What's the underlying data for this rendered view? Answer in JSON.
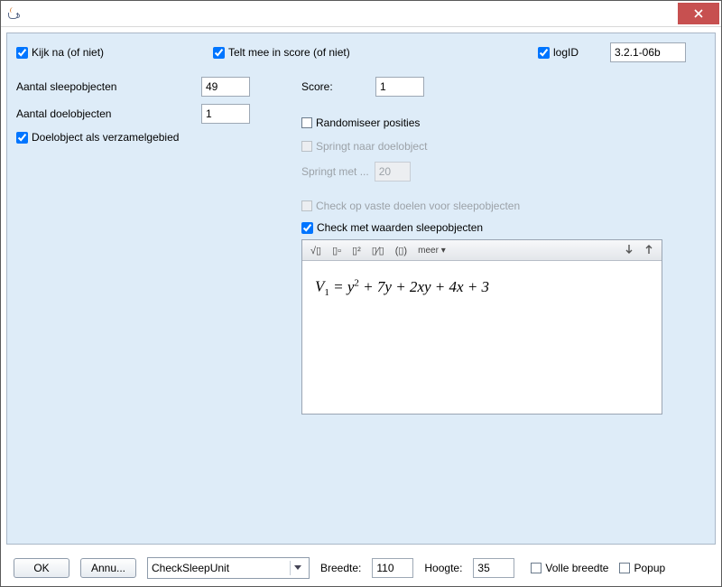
{
  "titlebar": {
    "title": ""
  },
  "top": {
    "kijk_na": {
      "label": "Kijk na (of niet)",
      "checked": true
    },
    "telt_mee": {
      "label": "Telt mee in score (of niet)",
      "checked": true
    },
    "logid_cb": {
      "label": "logID",
      "checked": true
    },
    "logid_value": "3.2.1-06b"
  },
  "left": {
    "aantal_sleep_label": "Aantal sleepobjecten",
    "aantal_sleep_value": "49",
    "aantal_doel_label": "Aantal doelobjecten",
    "aantal_doel_value": "1",
    "doel_verzamel": {
      "label": "Doelobject als verzamelgebied",
      "checked": true
    }
  },
  "right": {
    "score_label": "Score:",
    "score_value": "1",
    "randomiseer": {
      "label": "Randomiseer posities",
      "checked": false
    },
    "springt_doel": {
      "label": "Springt naar doelobject",
      "checked": false,
      "disabled": true
    },
    "springt_met_label": "Springt met ...",
    "springt_met_value": "20",
    "check_vaste": {
      "label": "Check op vaste doelen voor sleepobjecten",
      "checked": false,
      "disabled": true
    },
    "check_waarden": {
      "label": "Check met waarden sleepobjecten",
      "checked": true
    }
  },
  "eq_toolbar": {
    "b1": "√▯",
    "b2": "▯▫",
    "b3": "▯²",
    "b4": "▯⁄▯",
    "b5": "(▯)",
    "more": "meer"
  },
  "equation": {
    "lhs_var": "V",
    "lhs_sub": "1",
    "rhs_plain": " = y² + 7y + 2xy + 4x + 3"
  },
  "bottom": {
    "ok": "OK",
    "cancel": "Annu...",
    "combo": "CheckSleepUnit",
    "breedte_label": "Breedte:",
    "breedte_value": "110",
    "hoogte_label": "Hoogte:",
    "hoogte_value": "35",
    "volle_breedte": {
      "label": "Volle breedte",
      "checked": false
    },
    "popup": {
      "label": "Popup",
      "checked": false
    }
  }
}
